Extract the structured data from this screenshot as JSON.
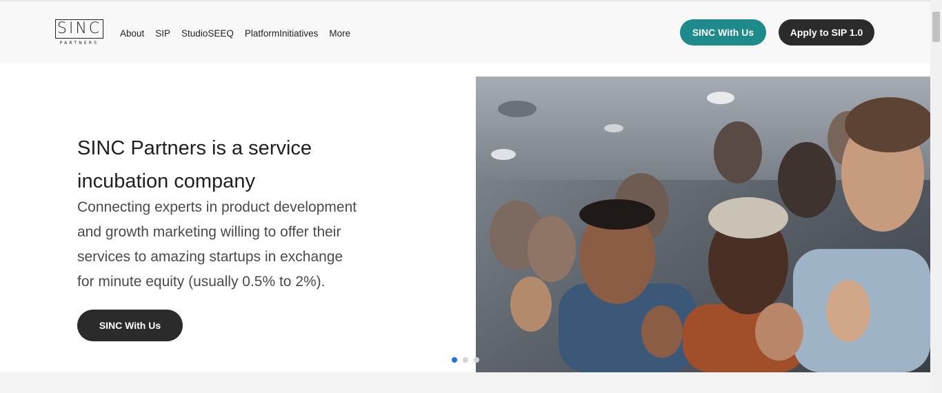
{
  "header": {
    "logo_text": "SINC",
    "logo_sub": "PARTNERS",
    "nav": [
      {
        "label": "About"
      },
      {
        "label": "SIP"
      },
      {
        "label": "StudioSEEQ"
      },
      {
        "label": "PlatformInitiatives"
      },
      {
        "label": "More"
      }
    ],
    "cta_primary": "SINC With Us",
    "cta_secondary": "Apply to SIP 1.0"
  },
  "hero": {
    "title_line1": "SINC Partners is a service",
    "title_line2": "incubation company",
    "description_lines": [
      "Connecting experts in product development",
      "and growth marketing willing to offer their",
      "services to amazing startups in exchange",
      "for minute equity (usually 0.5% to 2%)."
    ],
    "button_label": "SINC With Us"
  },
  "carousel": {
    "active_index": 0,
    "slides": 3
  },
  "colors": {
    "accent_teal": "#1f8a8c",
    "dark_button": "#2b2b2b",
    "active_dot": "#1a73e8"
  }
}
